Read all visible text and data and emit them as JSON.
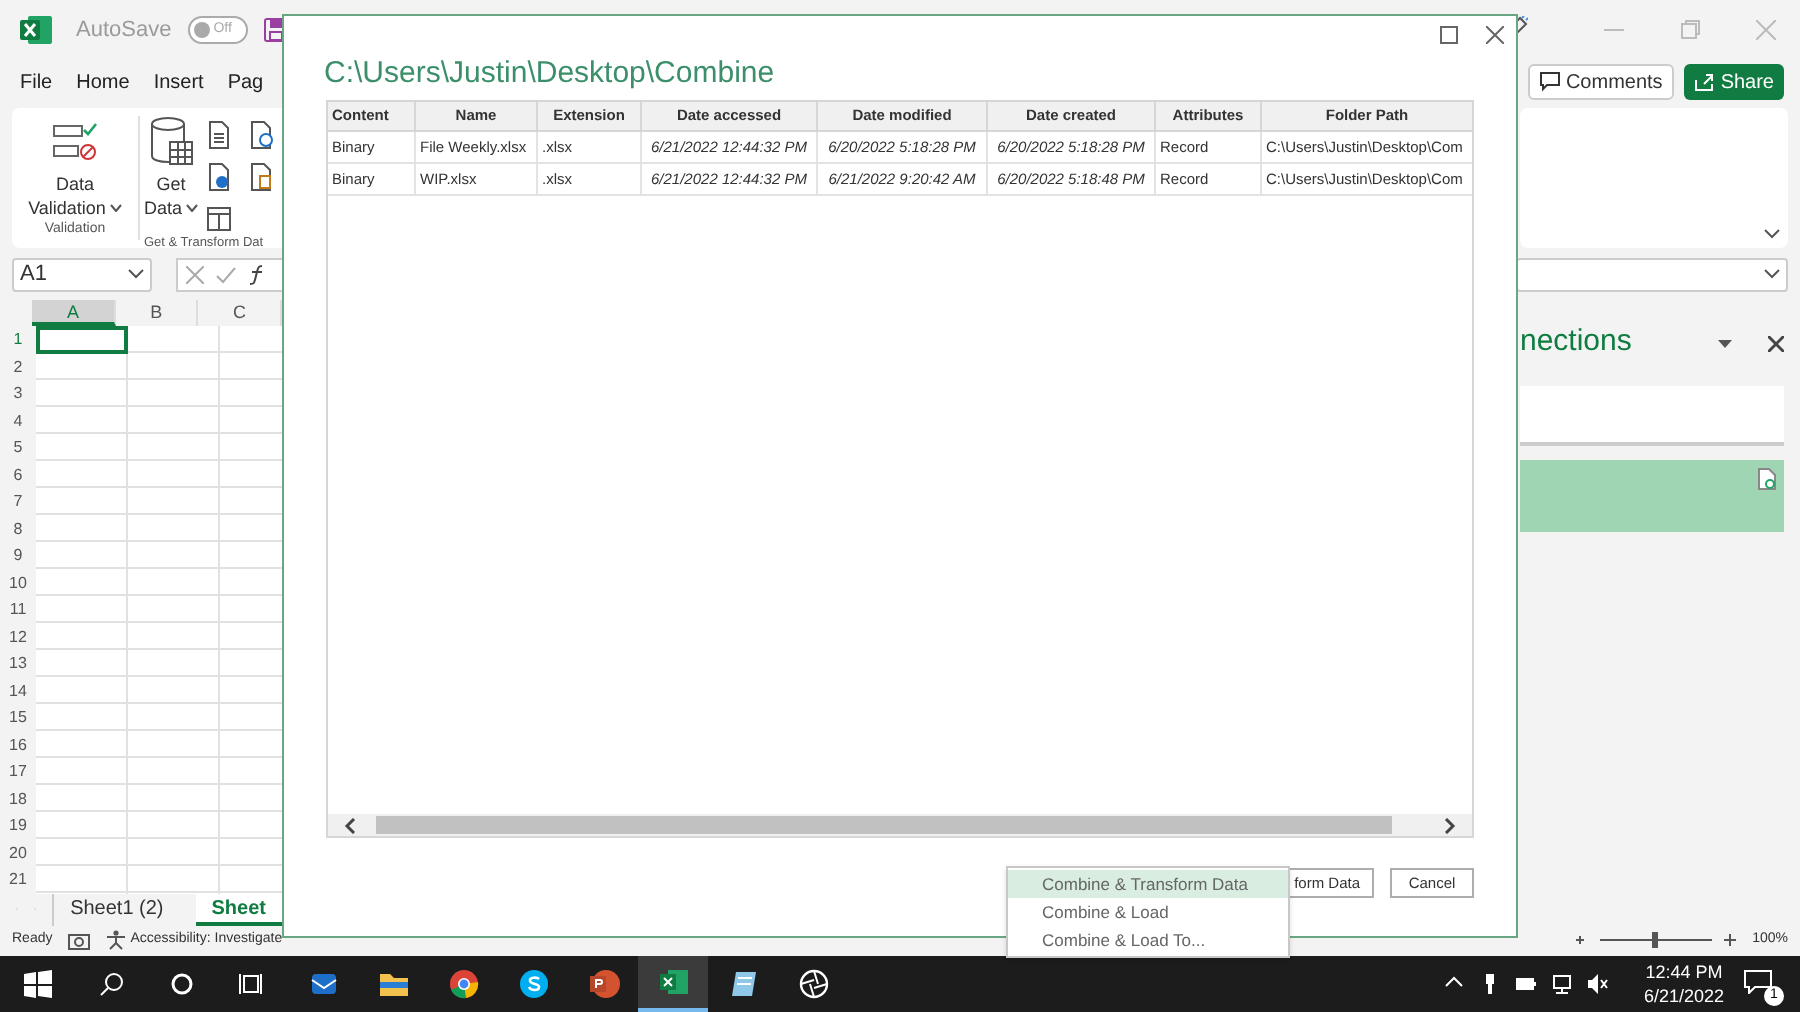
{
  "excel": {
    "autosave_label": "AutoSave",
    "autosave": {
      "on": false,
      "label": "Off"
    },
    "ribbon_tabs": [
      "File",
      "Home",
      "Insert",
      "Pag"
    ],
    "comments": "Comments",
    "share": "Share",
    "data_validation": [
      "Data",
      "Validation"
    ],
    "get_data": [
      "Get",
      "Data"
    ],
    "group_labels": [
      "Validation",
      "Get & Transform Dat"
    ],
    "name_box": "A1",
    "columns": [
      "A",
      "B",
      "C"
    ],
    "rows": [
      "1",
      "2",
      "3",
      "4",
      "5",
      "6",
      "7",
      "8",
      "9",
      "10",
      "11",
      "12",
      "13",
      "14",
      "15",
      "16",
      "17",
      "18",
      "19",
      "20",
      "21"
    ],
    "sheet_tabs": [
      {
        "label": "Sheet1 (2)",
        "selected": false
      },
      {
        "label": "Sheet",
        "selected": true
      }
    ],
    "status": "Ready",
    "accessibility": "Accessibility: Investigate",
    "zoom": "100%",
    "pane_title": "nections"
  },
  "dialog": {
    "title": "C:\\Users\\Justin\\Desktop\\Combine",
    "columns": [
      "Content",
      "Name",
      "Extension",
      "Date accessed",
      "Date modified",
      "Date created",
      "Attributes",
      "Folder Path"
    ],
    "rows": [
      [
        "Binary",
        "File Weekly.xlsx",
        ".xlsx",
        "6/21/2022 12:44:32 PM",
        "6/20/2022 5:18:28 PM",
        "6/20/2022 5:18:28 PM",
        "Record",
        "C:\\Users\\Justin\\Desktop\\Com"
      ],
      [
        "Binary",
        "WIP.xlsx",
        ".xlsx",
        "6/21/2022 12:44:32 PM",
        "6/21/2022 9:20:42 AM",
        "6/20/2022 5:18:48 PM",
        "Record",
        "C:\\Users\\Justin\\Desktop\\Com"
      ]
    ],
    "buttons": [
      "form Data",
      "Cancel"
    ]
  },
  "menu": [
    {
      "label": "Combine & Transform Data",
      "selected": true
    },
    {
      "label": "Combine & Load",
      "selected": false
    },
    {
      "label": "Combine & Load To...",
      "selected": false
    }
  ],
  "taskbar": {
    "time": "12:44 PM",
    "date": "6/21/2022",
    "notifications": "1"
  }
}
